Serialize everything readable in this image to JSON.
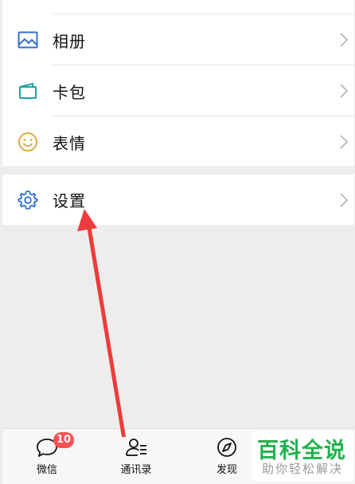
{
  "menu": {
    "items": [
      {
        "label": "相册",
        "icon": "album-icon"
      },
      {
        "label": "卡包",
        "icon": "card-wallet-icon"
      },
      {
        "label": "表情",
        "icon": "sticker-smile-icon"
      }
    ],
    "settings": {
      "label": "设置",
      "icon": "gear-icon"
    }
  },
  "tabbar": {
    "tabs": [
      {
        "label": "微信",
        "icon": "chat-bubble-icon",
        "badge": "10"
      },
      {
        "label": "通讯录",
        "icon": "contacts-icon"
      },
      {
        "label": "发现",
        "icon": "compass-icon"
      }
    ]
  },
  "watermark": {
    "title": "百科全说",
    "subtitle": "助你轻松解决"
  },
  "colors": {
    "album": "#2f6fd6",
    "card": "#23a0a8",
    "sticker": "#e0a93b",
    "settings": "#2f6fd6",
    "badge": "#fa5151",
    "annotation_arrow": "#ee3b3b",
    "watermark_green": "#22b14c"
  }
}
